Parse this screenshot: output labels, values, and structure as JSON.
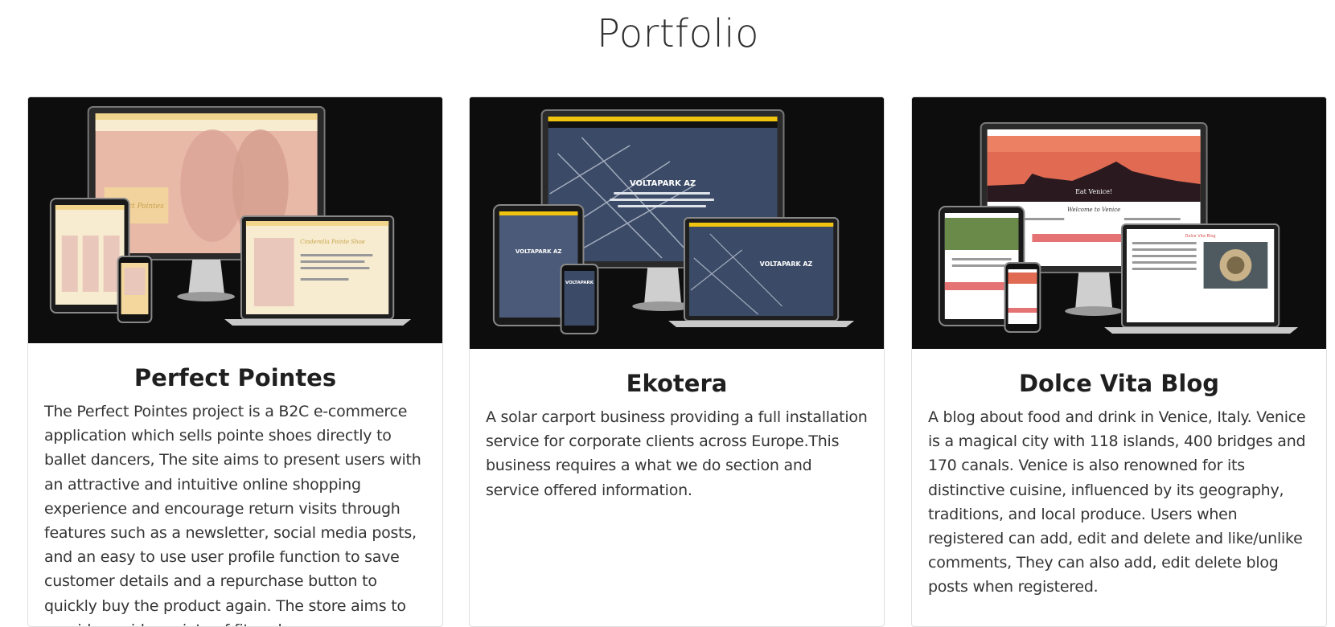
{
  "page": {
    "title": "Portfolio"
  },
  "projects": [
    {
      "title": "Perfect Pointes",
      "description": "The Perfect Pointes project is a B2C e-commerce application which sells pointe shoes directly to ballet dancers, The site aims to present users with an attractive and intuitive online shopping experience and encourage return visits through features such as a newsletter, social media posts, and an easy to use user profile function to save customer details and a repurchase button to quickly buy the product again. The store aims to provide a wide variety of fit and",
      "screens": {
        "headline": "Perfect Pointes",
        "sub": "Cinderella Pointe Shoe"
      }
    },
    {
      "title": "Ekotera",
      "description": "A solar carport business providing a full installation service for corporate clients across Europe.This business requires a what we do section and service offered information.",
      "screens": {
        "headline": "VOLTAPARK AZ"
      }
    },
    {
      "title": "Dolce Vita Blog",
      "description": "A blog about food and drink in Venice, Italy. Venice is a magical city with 118 islands, 400 bridges and 170 canals. Venice is also renowned for its distinctive cuisine, influenced by its geography, traditions, and local produce. Users when registered can add, edit and delete and like/unlike comments, They can also add, edit delete blog posts when registered.",
      "screens": {
        "headline": "Eat Venice!",
        "sub": "Welcome to Venice"
      }
    }
  ],
  "colors": {
    "image_bg": "#0e0d0e",
    "pointes_bg": "#e9b9a8",
    "pointes_bar": "#f2d58c",
    "ekotera_sky": "#3b4a66",
    "ekotera_bar": "#f1c40f",
    "venice_sunset": "#e06a52",
    "venice_button": "#e57373"
  }
}
